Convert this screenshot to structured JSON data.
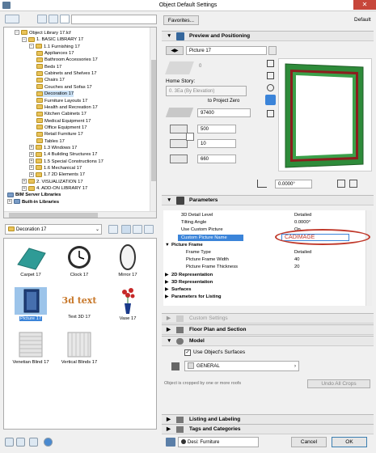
{
  "window": {
    "title": "Object Default Settings",
    "close": "✕"
  },
  "left": {
    "tree": [
      {
        "label": "Object Library 17.lcf",
        "indent": 1,
        "exp": "−"
      },
      {
        "label": "1. BASIC LIBRARY 17",
        "indent": 2,
        "exp": "−"
      },
      {
        "label": "1.1 Furnishing 17",
        "indent": 3,
        "exp": "−"
      },
      {
        "label": "Appliances 17",
        "indent": 4
      },
      {
        "label": "Bathroom Accessories 17",
        "indent": 4
      },
      {
        "label": "Beds 17",
        "indent": 4
      },
      {
        "label": "Cabinets and Shelves 17",
        "indent": 4
      },
      {
        "label": "Chairs 17",
        "indent": 4
      },
      {
        "label": "Couches and Sofas 17",
        "indent": 4
      },
      {
        "label": "Decoration 17",
        "indent": 4,
        "selected": true
      },
      {
        "label": "Furniture Layouts 17",
        "indent": 4
      },
      {
        "label": "Health and Recreation 17",
        "indent": 4
      },
      {
        "label": "Kitchen Cabinets 17",
        "indent": 4
      },
      {
        "label": "Medical Equipment 17",
        "indent": 4
      },
      {
        "label": "Office Equipment 17",
        "indent": 4
      },
      {
        "label": "Retail Furniture 17",
        "indent": 4
      },
      {
        "label": "Tables 17",
        "indent": 4
      },
      {
        "label": "1.3 Windows 17",
        "indent": 3,
        "exp": "+"
      },
      {
        "label": "1.4 Building Structures 17",
        "indent": 3,
        "exp": "+"
      },
      {
        "label": "1.5 Special Constructions 17",
        "indent": 3,
        "exp": "+"
      },
      {
        "label": "1.6 Mechanical 17",
        "indent": 3,
        "exp": "+"
      },
      {
        "label": "1.7 2D Elements 17",
        "indent": 3,
        "exp": "+"
      },
      {
        "label": "2. VISUALIZATION 17",
        "indent": 2,
        "exp": "+"
      },
      {
        "label": "4. ADD-ON LIBRARY 17",
        "indent": 2,
        "exp": "+"
      },
      {
        "label": "BIM Server Libraries",
        "indent": 0,
        "bold": true
      },
      {
        "label": "Built-in Libraries",
        "indent": 0,
        "bold": true,
        "exp": "+"
      }
    ],
    "folder_select": "Decoration 17",
    "items": [
      {
        "label": "Carpet 17"
      },
      {
        "label": "Clock 17"
      },
      {
        "label": "Mirror 17"
      },
      {
        "label": "Picture 17",
        "selected": true
      },
      {
        "label": "Text 3D 17"
      },
      {
        "label": "Vase 17"
      },
      {
        "label": "Venetian Blind 17"
      },
      {
        "label": "Vertical Blinds 17"
      }
    ],
    "text3d_label": "3d text"
  },
  "right": {
    "favorites": "Favorites...",
    "default": "Default",
    "preview": {
      "header": "Preview and Positioning",
      "object_name": "Picture 17",
      "home_story_label": "Home Story:",
      "home_story_value": "0. 3Ea (By Elevation)",
      "to_project_zero": "to Project Zero",
      "zero_value": "0",
      "elevation": "97400",
      "width": "500",
      "depth": "10",
      "height": "660",
      "angle": "0.0000°"
    },
    "params": {
      "header": "Parameters",
      "rows": [
        {
          "name": "3D Detail Level",
          "value": "Detailed"
        },
        {
          "name": "Tilting Angle",
          "value": "0.0000°"
        },
        {
          "name": "Use Custom Picture",
          "value": "On"
        },
        {
          "name": "Custom Picture Name",
          "value": "CADIMAGE",
          "selected": true
        },
        {
          "name": "Picture Frame",
          "value": "",
          "group": true,
          "open": true
        },
        {
          "name": "Frame Type",
          "value": "Detailed",
          "sub": true
        },
        {
          "name": "Picture Frame Width",
          "value": "40",
          "sub": true
        },
        {
          "name": "Picture Frame Thickness",
          "value": "20",
          "sub": true
        },
        {
          "name": "2D Representation",
          "value": "",
          "group": true
        },
        {
          "name": "3D Representation",
          "value": "",
          "group": true
        },
        {
          "name": "Surfaces",
          "value": "",
          "group": true
        },
        {
          "name": "Parameters for Listing",
          "value": "",
          "group": true
        }
      ]
    },
    "sections": {
      "custom": "Custom Settings",
      "floorplan": "Floor Plan and Section",
      "model": "Model",
      "listing": "Listing and Labeling",
      "tags": "Tags and Categories"
    },
    "model": {
      "use_surfaces": "Use Object's Surfaces",
      "surface": "GENERAL",
      "note": "Object is cropped by one or more roofs",
      "undo_crops": "Undo All Crops"
    },
    "footer": {
      "layer": "Desi: Furniture",
      "cancel": "Cancel",
      "ok": "OK"
    }
  },
  "colors": {
    "accent": "#3b84d9",
    "frame": "#2e8b3a",
    "highlight": "#c0392b"
  }
}
